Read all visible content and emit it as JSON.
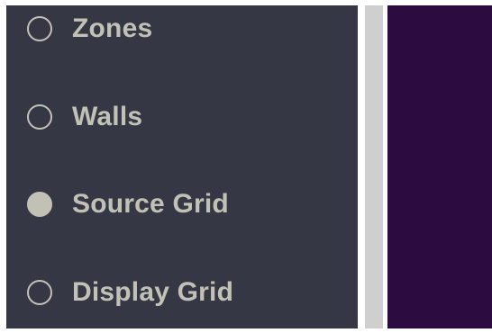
{
  "options": [
    {
      "label": "Zones",
      "checked": false
    },
    {
      "label": "Walls",
      "checked": false
    },
    {
      "label": "Source Grid",
      "checked": true
    },
    {
      "label": "Display Grid",
      "checked": false
    }
  ],
  "colors": {
    "sidebar_bg": "#353844",
    "label_color": "#c2c1b6",
    "divider": "#cfcfcf",
    "canvas_bg": "#2c0b40"
  },
  "icons": {
    "radio_unchecked": "radio-unchecked-icon",
    "radio_checked": "radio-checked-icon"
  }
}
